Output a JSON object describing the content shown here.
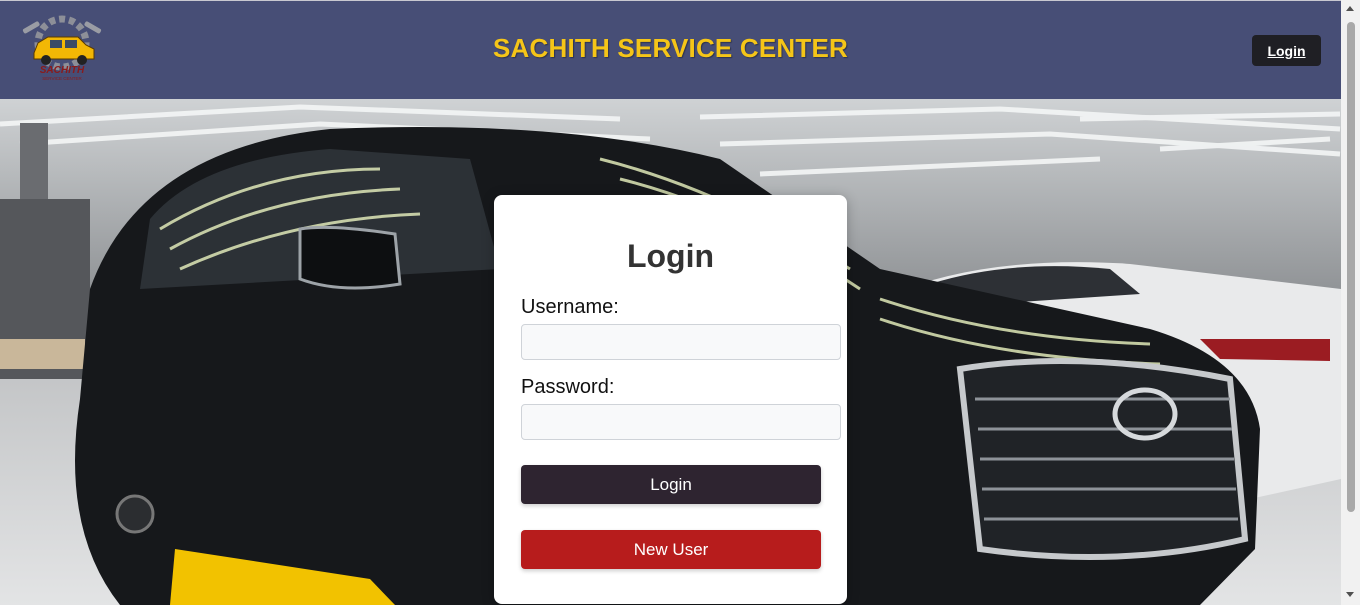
{
  "header": {
    "title": "SACHITH SERVICE CENTER",
    "login_label": "Login",
    "logo": {
      "text": "SACHITH",
      "subtext": "SERVICE CENTER",
      "icon": "car-gear-logo"
    }
  },
  "login_form": {
    "title": "Login",
    "username_label": "Username:",
    "username_value": "",
    "password_label": "Password:",
    "password_value": "",
    "login_button": "Login",
    "new_user_button": "New User"
  },
  "colors": {
    "header_bg": "#474e76",
    "title_color": "#f5c518",
    "login_button": "#2e2430",
    "new_user_button": "#b71c1c"
  }
}
